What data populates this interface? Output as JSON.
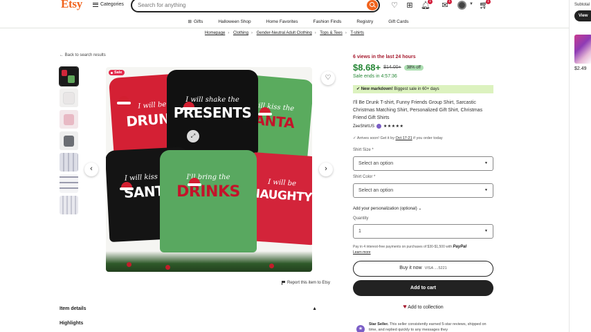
{
  "header": {
    "logo": "Etsy",
    "categories_label": "Categories",
    "search_placeholder": "Search for anything",
    "cart_badge": "1",
    "notif_badge": "1"
  },
  "subnav": [
    "Gifts",
    "Halloween Shop",
    "Home Favorites",
    "Fashion Finds",
    "Registry",
    "Gift Cards"
  ],
  "breadcrumb": [
    "Homepage",
    "Clothing",
    "Gender-Neutral Adult Clothing",
    "Tops & Tees",
    "T-shirts"
  ],
  "side_panel": {
    "subtotal_label": "Subtotal",
    "view_label": "View",
    "item_price": "$2.49"
  },
  "product": {
    "back_link": "Back to search results",
    "sale_tag": "Sale",
    "report_link": "Report this item to Etsy",
    "item_details": "Item details",
    "highlights": "Highlights",
    "shirts": [
      {
        "line1": "I will be",
        "line2": "DRUNK"
      },
      {
        "line1": "I will shake the",
        "line2": "PRESENTS"
      },
      {
        "line1": "I will kiss the",
        "line2": "SANTA"
      },
      {
        "line1": "I will kiss the",
        "line2": "SANTA"
      },
      {
        "line1": "I'll bring the",
        "line2": "DRINKS"
      },
      {
        "line1": "I will be",
        "line2": "NAUGHTY"
      }
    ]
  },
  "info": {
    "views": "6 views in the last 24 hours",
    "price_now": "$8.68+",
    "price_was": "$14.00+",
    "discount": "38% off",
    "sale_ends": "Sale ends in 4:57:36",
    "markdown_bold": "New markdown!",
    "markdown_rest": " Biggest sale in 60+ days",
    "title": "I'll Be Drunk T-shirt, Funny Friends Group Shirt, Sarcastic Christmas Matching Shirt, Personalized Gift Shirt, Christmas Friend Gift Shirts",
    "shop_name": "ZeeShirtUS",
    "stars": "★★★★★",
    "arrives_pre": "Arrives soon! Get it by ",
    "arrives_date": "Oct 17-21",
    "arrives_post": " if you order today",
    "size_label": "Shirt Size *",
    "size_value": "Select an option",
    "color_label": "Shirt Color *",
    "color_value": "Select an option",
    "personalization": "Add your personalization (optional)",
    "quantity_label": "Quantity",
    "quantity_value": "1",
    "klarna_text": "Pay in 4 interest-free payments on purchases of $30-$1,500 with ",
    "klarna_brand": "PayPal",
    "learn_more": "Learn more",
    "buy_now": "Buy it now",
    "visa": "VISA  ....5221",
    "add_to_cart": "Add to cart",
    "add_collection": "Add to collection",
    "star_seller_bold": "Star Seller.",
    "star_seller_text": " This seller consistently earned 5-star reviews, shipped on time, and replied quickly to any messages they"
  },
  "colors": {
    "brand": "#f1641e",
    "price_green": "#258635",
    "views_red": "#a61a2e"
  }
}
